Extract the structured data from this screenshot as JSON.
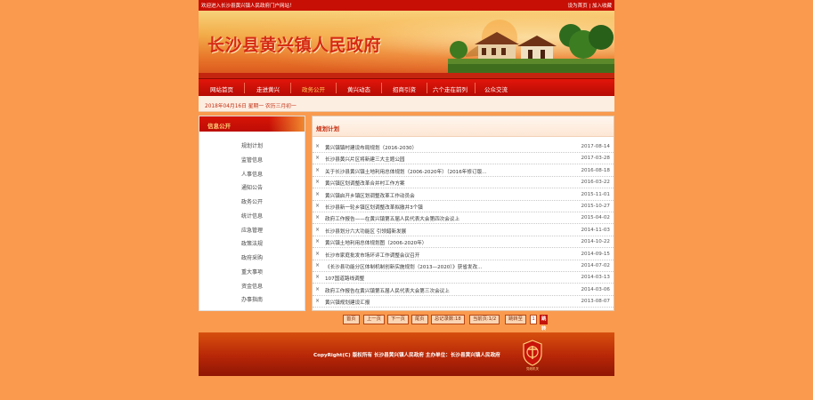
{
  "topbar": {
    "welcome": "欢迎进入长沙县黄兴镇人民政府门户网站！",
    "set_home": "设为首页",
    "separator": "|",
    "add_fav": "加入收藏"
  },
  "header": {
    "site_title": "长沙县黄兴镇人民政府"
  },
  "nav": {
    "items": [
      "网站首页",
      "走进黄兴",
      "政务公开",
      "黄兴动态",
      "招商引资",
      "六个走在前列",
      "公众交流"
    ],
    "active_index": 2
  },
  "datebar": {
    "text": "2018年04月16日 星期一 农历三月初一"
  },
  "sidebar": {
    "title": "信息公开",
    "items": [
      "规划计划",
      "监管信息",
      "人事信息",
      "通知公告",
      "政务公开",
      "统计信息",
      "应急管理",
      "政策法规",
      "政府采购",
      "重大事项",
      "资金信息",
      "办事指南"
    ]
  },
  "content": {
    "title": "规划计划",
    "bullet": "×",
    "rows": [
      {
        "title": "黄兴镇镇村建设布局规划（2016-2030）",
        "date": "2017-08-14"
      },
      {
        "title": "长沙县黄兴片区将新建三大主题公园",
        "date": "2017-03-28"
      },
      {
        "title": "关于长沙县黄兴镇土地利用总体规划（2006-2020年）（2016年修订版...",
        "date": "2016-08-18"
      },
      {
        "title": "黄兴镇区划调整改革合并村工作方案",
        "date": "2016-03-22"
      },
      {
        "title": "黄兴镇启开乡镇区划调整改革工作动员会",
        "date": "2015-11-01"
      },
      {
        "title": "长沙县新一轮乡镇区划调整改革拟撤并3个镇",
        "date": "2015-10-27"
      },
      {
        "title": "政府工作报告——在黄兴镇第五届人民代表大会第四次会议上",
        "date": "2015-04-02"
      },
      {
        "title": "长沙县划分六大功能区 引领錯新发展",
        "date": "2014-11-03"
      },
      {
        "title": "黄兴镇土地利用总体规划图（2006-2020年）",
        "date": "2014-10-22"
      },
      {
        "title": "长沙市家庭批发市场环评工作调整会议召开",
        "date": "2014-09-15"
      },
      {
        "title": "《长沙县功能分区体制机制创新实施规划（2013—2020）》获省发改...",
        "date": "2014-07-02"
      },
      {
        "title": "107国道路线调整",
        "date": "2014-03-13"
      },
      {
        "title": "政府工作报告在黄兴镇第五届人民代表大会第三次会议上",
        "date": "2014-03-06"
      },
      {
        "title": "黄兴镇规划建设汇报",
        "date": "2013-08-07"
      }
    ]
  },
  "pager": {
    "first": "首页",
    "prev": "上一页",
    "next": "下一页",
    "last": "尾页",
    "total": "总记录数:18",
    "current": "当前页:1/2",
    "jump": "跳转至",
    "page_value": "1",
    "go": "跳转"
  },
  "footer": {
    "copyright": "CopyRight(C) 版权所有 长沙县黄兴镇人民政府 主办单位：长沙县黄兴镇人民政府",
    "emblem_label": "党政机关"
  },
  "colors": {
    "background": "#f99a4e",
    "brand_red": "#c70f05",
    "accent_gold": "#ffca5a"
  }
}
